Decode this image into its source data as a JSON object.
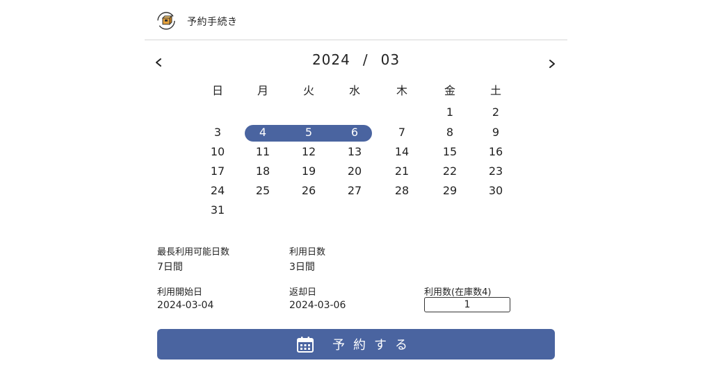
{
  "header": {
    "title": "予約手続き",
    "logo_icon": "box-cycle-icon"
  },
  "calendar": {
    "year": "2024",
    "separator": "/",
    "month": "03",
    "prev_icon": "chevron-left-icon",
    "next_icon": "chevron-right-icon",
    "weekdays": [
      "日",
      "月",
      "火",
      "水",
      "木",
      "金",
      "土"
    ],
    "weeks": [
      [
        "",
        "",
        "",
        "",
        "",
        "1",
        "2"
      ],
      [
        "3",
        "4",
        "5",
        "6",
        "7",
        "8",
        "9"
      ],
      [
        "10",
        "11",
        "12",
        "13",
        "14",
        "15",
        "16"
      ],
      [
        "17",
        "18",
        "19",
        "20",
        "21",
        "22",
        "23"
      ],
      [
        "24",
        "25",
        "26",
        "27",
        "28",
        "29",
        "30"
      ],
      [
        "31",
        "",
        "",
        "",
        "",
        "",
        ""
      ]
    ],
    "selected_days": [
      "4",
      "5",
      "6"
    ],
    "accent_color": "#4a64a0"
  },
  "info": {
    "max_days_label": "最長利用可能日数",
    "max_days_value": "7日間",
    "use_days_label": "利用日数",
    "use_days_value": "3日間",
    "start_label": "利用開始日",
    "start_value": "2024-03-04",
    "return_label": "返却日",
    "return_value": "2024-03-06",
    "qty_label": "利用数(在庫数4)",
    "qty_value": "1"
  },
  "reserve": {
    "label": "予約する",
    "icon": "calendar-icon",
    "color": "#4a64a0"
  }
}
